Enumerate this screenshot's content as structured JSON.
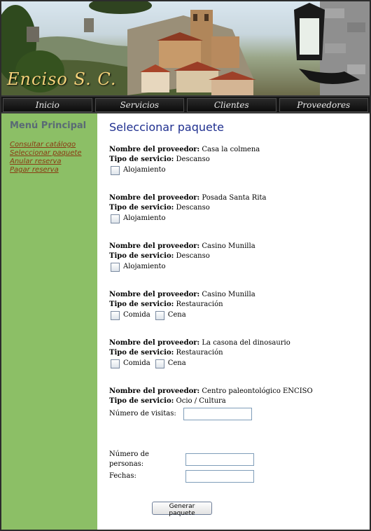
{
  "header": {
    "brand": "Enciso S. C."
  },
  "nav": {
    "items": [
      "Inicio",
      "Servicios",
      "Clientes",
      "Proveedores"
    ]
  },
  "sidebar": {
    "title": "Menú Principal",
    "links": [
      "Consultar catálogo",
      "Seleccionar paquete",
      "Anular reserva",
      "Pagar reserva"
    ]
  },
  "main": {
    "title": "Seleccionar paquete",
    "provider_label": "Nombre del proveedor:",
    "service_label": "Tipo de servicio:",
    "providers": [
      {
        "name": "Casa la colmena",
        "service": "Descanso",
        "options": [
          "Alojamiento"
        ]
      },
      {
        "name": "Posada Santa Rita",
        "service": "Descanso",
        "options": [
          "Alojamiento"
        ]
      },
      {
        "name": "Casino Munilla",
        "service": "Descanso",
        "options": [
          "Alojamiento"
        ]
      },
      {
        "name": "Casino Munilla",
        "service": "Restauración",
        "options": [
          "Comida",
          "Cena"
        ]
      },
      {
        "name": "La casona del dinosaurio",
        "service": "Restauración",
        "options": [
          "Comida",
          "Cena"
        ]
      },
      {
        "name": "Centro paleontológico ENCISO",
        "service": "Ocio / Cultura",
        "visits_label": "Número de visitas:"
      }
    ],
    "persons_label": "Número de personas:",
    "dates_label": "Fechas:",
    "submit_label": "Generar paquete"
  },
  "colors": {
    "sidebar_bg": "#8cbf66",
    "title_color": "#1f2f8f",
    "link_color": "#8a3a12",
    "nav_bg": "#151515"
  }
}
